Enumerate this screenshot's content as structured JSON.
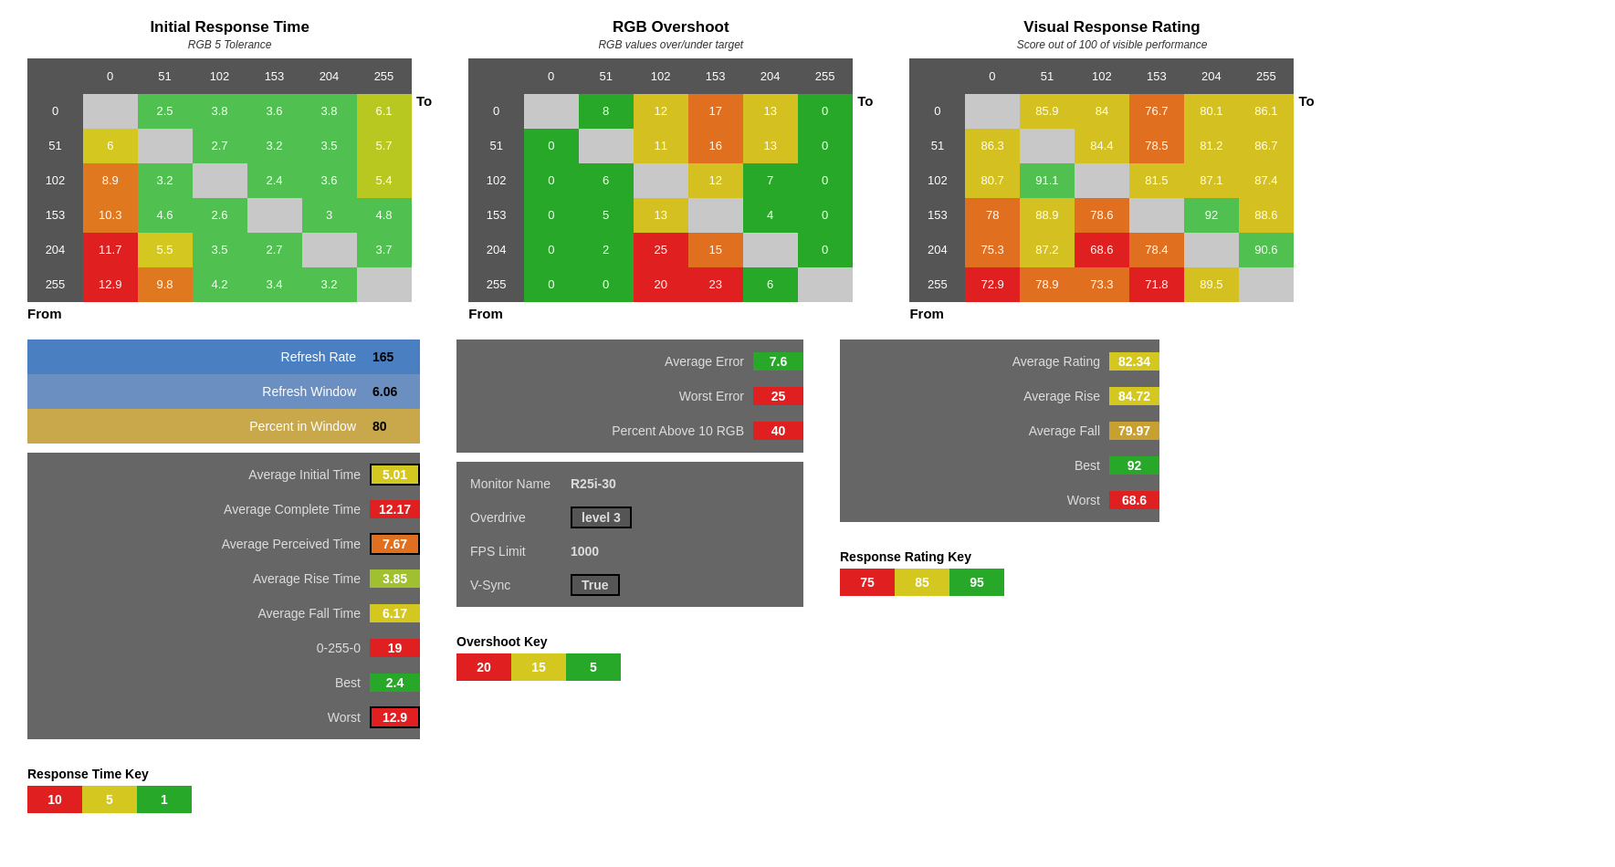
{
  "heatmaps": {
    "response_time": {
      "title": "Initial Response Time",
      "subtitle": "RGB 5 Tolerance",
      "col_headers": [
        "0",
        "51",
        "102",
        "153",
        "204",
        "255"
      ],
      "rows": [
        {
          "label": "0",
          "values": [
            "",
            "2.5",
            "3.8",
            "3.6",
            "3.8",
            "6.1"
          ],
          "colors": [
            "empty",
            "green",
            "green",
            "green",
            "green",
            "yellow"
          ]
        },
        {
          "label": "51",
          "values": [
            "6",
            "",
            "2.7",
            "3.2",
            "3.5",
            "5.7"
          ],
          "colors": [
            "yellow",
            "empty",
            "green",
            "green",
            "green",
            "yellow"
          ]
        },
        {
          "label": "102",
          "values": [
            "8.9",
            "3.2",
            "",
            "2.4",
            "3.6",
            "5.4"
          ],
          "colors": [
            "orange",
            "green",
            "empty",
            "green",
            "green",
            "yellow"
          ]
        },
        {
          "label": "153",
          "values": [
            "10.3",
            "4.6",
            "2.6",
            "",
            "3",
            "4.8"
          ],
          "colors": [
            "orange",
            "green",
            "green",
            "empty",
            "green",
            "green"
          ]
        },
        {
          "label": "204",
          "values": [
            "11.7",
            "5.5",
            "3.5",
            "2.7",
            "",
            "3.7"
          ],
          "colors": [
            "red",
            "yellow",
            "green",
            "green",
            "empty",
            "green"
          ]
        },
        {
          "label": "255",
          "values": [
            "12.9",
            "9.8",
            "4.2",
            "3.4",
            "3.2",
            ""
          ],
          "colors": [
            "red",
            "orange",
            "green",
            "green",
            "green",
            "empty"
          ]
        }
      ]
    },
    "overshoot": {
      "title": "RGB Overshoot",
      "subtitle": "RGB values over/under target",
      "col_headers": [
        "0",
        "51",
        "102",
        "153",
        "204",
        "255"
      ],
      "rows": [
        {
          "label": "0",
          "values": [
            "",
            "8",
            "12",
            "17",
            "13",
            "0"
          ],
          "colors": [
            "empty",
            "green",
            "yellow",
            "orange",
            "yellow",
            "green"
          ]
        },
        {
          "label": "51",
          "values": [
            "0",
            "",
            "11",
            "16",
            "13",
            "0"
          ],
          "colors": [
            "green",
            "empty",
            "yellow",
            "orange",
            "yellow",
            "green"
          ]
        },
        {
          "label": "102",
          "values": [
            "0",
            "6",
            "",
            "12",
            "7",
            "0"
          ],
          "colors": [
            "green",
            "green",
            "empty",
            "yellow",
            "green",
            "green"
          ]
        },
        {
          "label": "153",
          "values": [
            "0",
            "5",
            "13",
            "",
            "4",
            "0"
          ],
          "colors": [
            "green",
            "green",
            "yellow",
            "empty",
            "green",
            "green"
          ]
        },
        {
          "label": "204",
          "values": [
            "0",
            "2",
            "25",
            "15",
            "",
            "0"
          ],
          "colors": [
            "green",
            "green",
            "red",
            "orange",
            "empty",
            "green"
          ]
        },
        {
          "label": "255",
          "values": [
            "0",
            "0",
            "20",
            "23",
            "6",
            ""
          ],
          "colors": [
            "green",
            "green",
            "red",
            "red",
            "green",
            "empty"
          ]
        }
      ]
    },
    "visual_rating": {
      "title": "Visual Response Rating",
      "subtitle": "Score out of 100 of visible performance",
      "col_headers": [
        "0",
        "51",
        "102",
        "153",
        "204",
        "255"
      ],
      "rows": [
        {
          "label": "0",
          "values": [
            "",
            "85.9",
            "84",
            "76.7",
            "80.1",
            "86.1"
          ],
          "colors": [
            "empty",
            "yellow",
            "yellow",
            "orange",
            "yellow",
            "yellow"
          ]
        },
        {
          "label": "51",
          "values": [
            "86.3",
            "",
            "84.4",
            "78.5",
            "81.2",
            "86.7"
          ],
          "colors": [
            "yellow",
            "empty",
            "yellow",
            "orange",
            "yellow",
            "yellow"
          ]
        },
        {
          "label": "102",
          "values": [
            "80.7",
            "91.1",
            "",
            "81.5",
            "87.1",
            "87.4"
          ],
          "colors": [
            "yellow",
            "green",
            "empty",
            "yellow",
            "yellow",
            "yellow"
          ]
        },
        {
          "label": "153",
          "values": [
            "78",
            "88.9",
            "78.6",
            "",
            "92",
            "88.6"
          ],
          "colors": [
            "orange",
            "yellow",
            "orange",
            "empty",
            "green",
            "yellow"
          ]
        },
        {
          "label": "204",
          "values": [
            "75.3",
            "87.2",
            "68.6",
            "78.4",
            "",
            "90.6"
          ],
          "colors": [
            "orange",
            "yellow",
            "red",
            "orange",
            "empty",
            "green"
          ]
        },
        {
          "label": "255",
          "values": [
            "72.9",
            "78.9",
            "73.3",
            "71.8",
            "89.5",
            ""
          ],
          "colors": [
            "red",
            "orange",
            "orange",
            "red",
            "yellow",
            "empty"
          ]
        }
      ]
    }
  },
  "refresh_stats": {
    "label1": "Refresh Rate",
    "value1": "165",
    "label2": "Refresh Window",
    "value2": "6.06",
    "label3": "Percent in Window",
    "value3": "80"
  },
  "time_stats": {
    "rows": [
      {
        "label": "Average Initial Time",
        "value": "5.01",
        "color": "yellow",
        "bordered": true
      },
      {
        "label": "Average Complete Time",
        "value": "12.17",
        "color": "red",
        "bordered": false
      },
      {
        "label": "Average Perceived Time",
        "value": "7.67",
        "color": "orange",
        "bordered": true
      },
      {
        "label": "Average Rise Time",
        "value": "3.85",
        "color": "yellow-green",
        "bordered": false
      },
      {
        "label": "Average Fall Time",
        "value": "6.17",
        "color": "yellow",
        "bordered": false
      },
      {
        "label": "0-255-0",
        "value": "19",
        "color": "red",
        "bordered": false
      },
      {
        "label": "Best",
        "value": "2.4",
        "color": "green",
        "bordered": false
      },
      {
        "label": "Worst",
        "value": "12.9",
        "color": "red",
        "bordered": true
      }
    ]
  },
  "error_stats": {
    "rows": [
      {
        "label": "Average Error",
        "value": "7.6",
        "color": "green"
      },
      {
        "label": "Worst Error",
        "value": "25",
        "color": "red"
      },
      {
        "label": "Percent Above 10 RGB",
        "value": "40",
        "color": "red"
      }
    ]
  },
  "monitor_info": {
    "name_label": "Monitor Name",
    "name_value": "R25i-30",
    "overdrive_label": "Overdrive",
    "overdrive_value": "level 3",
    "fps_label": "FPS Limit",
    "fps_value": "1000",
    "vsync_label": "V-Sync",
    "vsync_value": "True"
  },
  "rating_stats": {
    "rows": [
      {
        "label": "Average Rating",
        "value": "82.34",
        "color": "yellow"
      },
      {
        "label": "Average Rise",
        "value": "84.72",
        "color": "yellow"
      },
      {
        "label": "Average Fall",
        "value": "79.97",
        "color": "orange"
      },
      {
        "label": "Best",
        "value": "92",
        "color": "green"
      },
      {
        "label": "Worst",
        "value": "68.6",
        "color": "red"
      }
    ]
  },
  "keys": {
    "response_time": {
      "title": "Response Time Key",
      "items": [
        {
          "value": "10",
          "color": "red"
        },
        {
          "value": "5",
          "color": "yellow"
        },
        {
          "value": "1",
          "color": "green"
        }
      ]
    },
    "overshoot": {
      "title": "Overshoot Key",
      "items": [
        {
          "value": "20",
          "color": "red"
        },
        {
          "value": "15",
          "color": "yellow"
        },
        {
          "value": "5",
          "color": "green"
        }
      ]
    },
    "rating": {
      "title": "Response Rating Key",
      "items": [
        {
          "value": "75",
          "color": "red"
        },
        {
          "value": "85",
          "color": "yellow"
        },
        {
          "value": "95",
          "color": "green"
        }
      ]
    }
  },
  "labels": {
    "to": "To",
    "from": "From"
  }
}
